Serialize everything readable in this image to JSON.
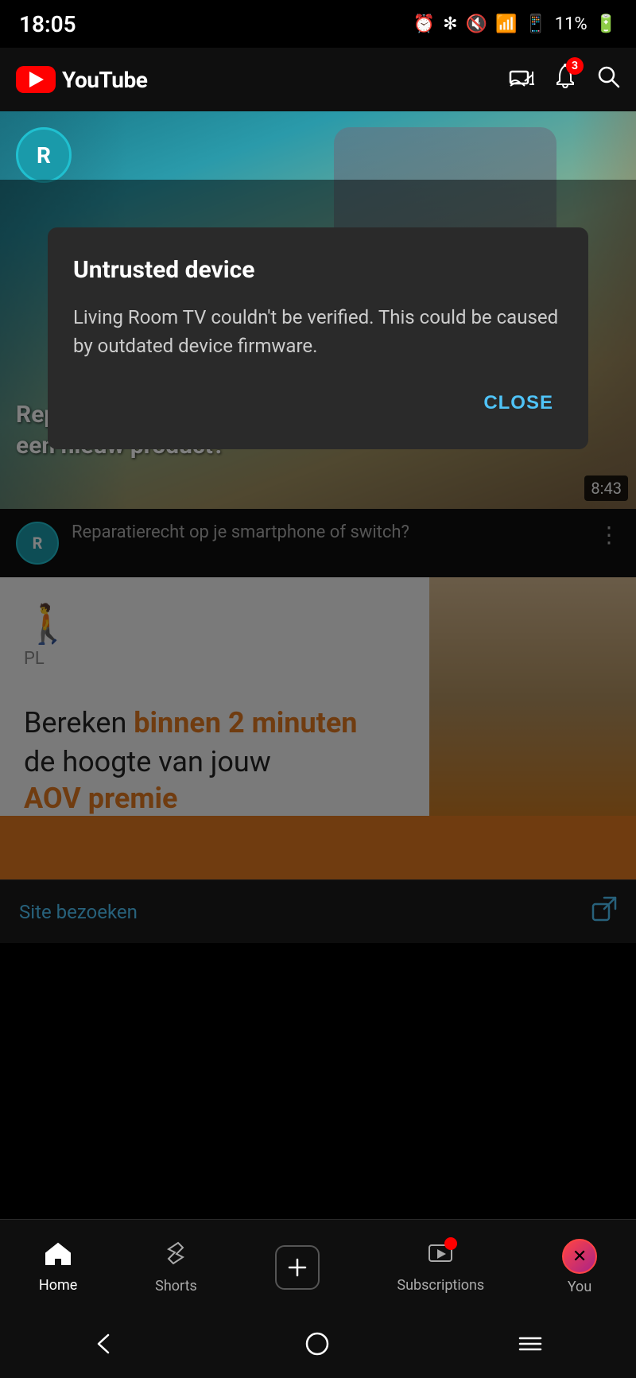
{
  "statusBar": {
    "time": "18:05",
    "battery": "11%"
  },
  "navBar": {
    "logo": "YouTube",
    "notificationCount": "3"
  },
  "videoHero": {
    "channelInitial": "R",
    "overlayLine1": "Reparatie of wéér",
    "overlayLine2": "een nieuw product?",
    "duration": "8:43"
  },
  "videoInfo": {
    "channelInitial": "R",
    "title": "Reparatierecht op je smartphone of switch?"
  },
  "dialog": {
    "title": "Untrusted device",
    "message": "Living Room TV couldn't be verified. This could be caused by outdated device firmware.",
    "closeLabel": "CLOSE"
  },
  "contentCard": {
    "line1prefix": "Bereken ",
    "line1highlight": "binnen 2 minuten",
    "line2": "de hoogte van jouw",
    "line3": "AOV premie"
  },
  "siteLinkBar": {
    "label": "Site bezoeken"
  },
  "bottomNav": {
    "items": [
      {
        "id": "home",
        "label": "Home",
        "icon": "⌂",
        "active": true
      },
      {
        "id": "shorts",
        "label": "Shorts",
        "icon": "✂",
        "active": false
      },
      {
        "id": "create",
        "label": "",
        "icon": "+",
        "active": false
      },
      {
        "id": "subscriptions",
        "label": "Subscriptions",
        "icon": "▶",
        "active": false
      },
      {
        "id": "you",
        "label": "You",
        "icon": "👤",
        "active": false
      }
    ]
  },
  "sysNav": {
    "backIcon": "‹",
    "homeIcon": "○",
    "recentIcon": "|||"
  }
}
